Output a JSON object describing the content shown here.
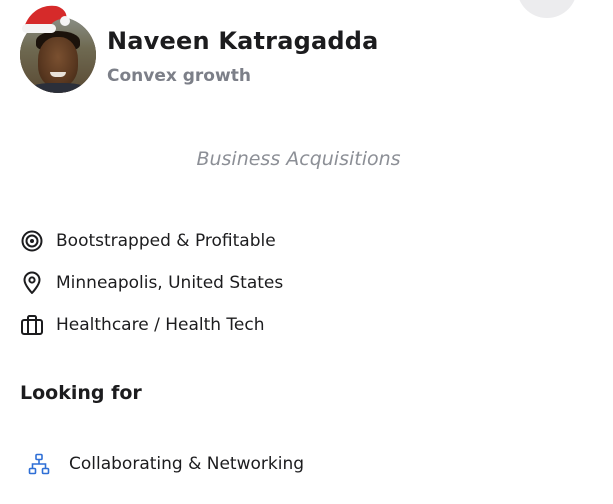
{
  "profile": {
    "name": "Naveen Katragadda",
    "company": "Convex growth",
    "tagline": "Business Acquisitions",
    "avatar_icon": "avatar-photo-with-santa-hat"
  },
  "details": [
    {
      "icon": "target-icon",
      "label": "Bootstrapped & Profitable"
    },
    {
      "icon": "location-pin-icon",
      "label": "Minneapolis, United States"
    },
    {
      "icon": "briefcase-icon",
      "label": "Healthcare / Health Tech"
    }
  ],
  "looking_for": {
    "title": "Looking for",
    "items": [
      {
        "icon": "network-icon",
        "label": "Collaborating & Networking"
      }
    ]
  },
  "colors": {
    "text_primary": "#1c1c1e",
    "text_secondary": "#7c7f88",
    "tagline": "#8c8f96",
    "network_icon": "#2f6fd6"
  }
}
